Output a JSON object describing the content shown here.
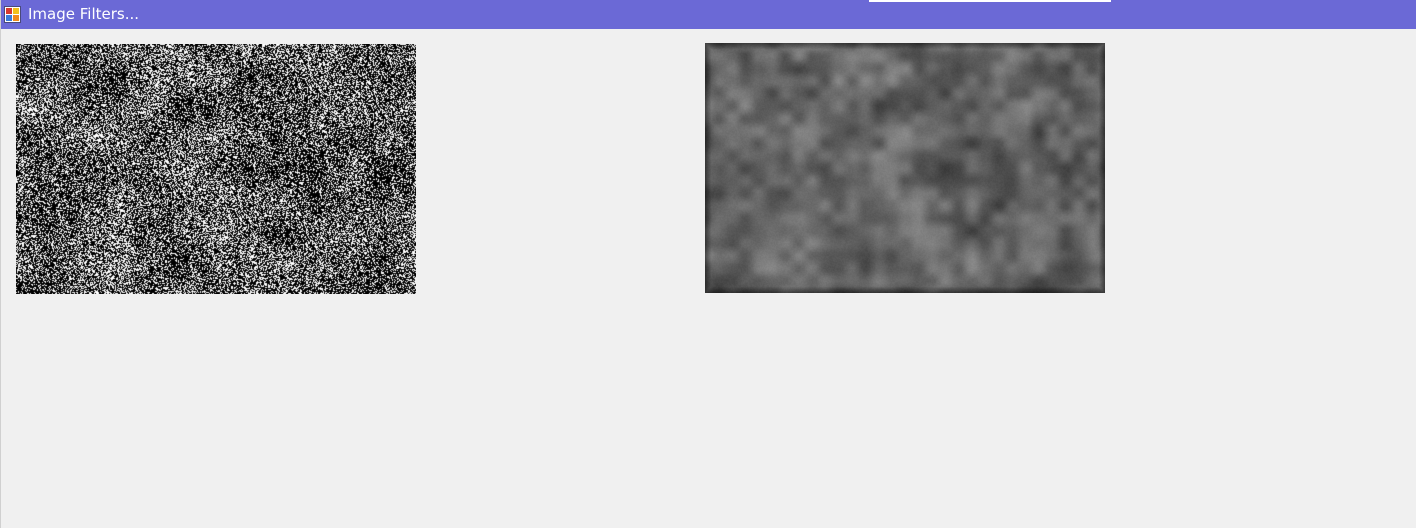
{
  "window": {
    "title": "Image Filters...",
    "title_bar_color": "#6b69d6",
    "background_color": "#f0f0f0"
  },
  "icons": {
    "app": "app-window-icon"
  },
  "pictures": {
    "original": {
      "description_icon": "noise-image",
      "noise_type": "salt-and-pepper"
    },
    "filtered": {
      "description_icon": "blurred-noise-image",
      "noise_type": "smoothed"
    }
  }
}
